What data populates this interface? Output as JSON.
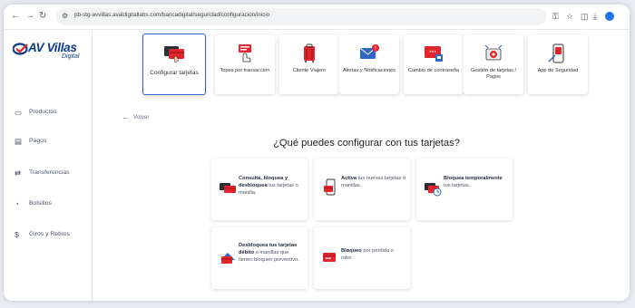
{
  "browser": {
    "url": "pb-stg-avvillas.avaldigitallabs.com/bancadigital/seguridad/configuracion/inicio",
    "back_icon": "arrow-left-icon",
    "forward_icon": "arrow-right-icon",
    "reload_icon": "reload-icon",
    "site_settings_icon": "tune-icon"
  },
  "logo": {
    "brand": "AV Villas",
    "sub": "Digital"
  },
  "sidebar": {
    "items": [
      {
        "label": "Productos",
        "icon": "product-icon"
      },
      {
        "label": "Pagos",
        "icon": "payments-icon"
      },
      {
        "label": "Transferencias",
        "icon": "transfer-icon"
      },
      {
        "label": "Bolsillos",
        "icon": "pocket-icon"
      },
      {
        "label": "Giros y Retiros",
        "icon": "withdraw-icon"
      }
    ]
  },
  "top_menu": [
    {
      "label": "Configurar tarjetas",
      "icon": "cards-hand-icon",
      "active": true
    },
    {
      "label": "Topes por transacción",
      "icon": "limits-icon"
    },
    {
      "label": "Cliente Viajero",
      "icon": "traveler-icon"
    },
    {
      "label": "Alertas y Notificaciones",
      "icon": "alert-mail-icon"
    },
    {
      "label": "Cambio de contraseña",
      "icon": "password-icon"
    },
    {
      "label": "Gestión de tarjetas / Pagos",
      "icon": "card-management-icon"
    },
    {
      "label": "App de Seguridad",
      "icon": "security-app-icon"
    }
  ],
  "content": {
    "back_label": "Volver",
    "heading": "¿Qué puedes configurar con tus tarjetas?"
  },
  "cards": [
    {
      "bold": "Consulta, bloquea y desbloquea",
      "rest": " tus tarjetas o manilla.",
      "icon": "cards-icon"
    },
    {
      "bold": "Activa",
      "rest": " tus nuevas tarjetas o manillas.",
      "icon": "activate-phone-icon"
    },
    {
      "bold_pre": "Bloquea ",
      "bold": "temporalmente",
      "rest": " tus tarjetas.",
      "icon": "temporary-lock-icon"
    },
    {
      "bold": "Desbloquea tus tarjetas débito",
      "rest": " o manillas que tienen bloqueo preventivo.",
      "icon": "unlock-debit-icon"
    },
    {
      "bold": "Bloqueo",
      "rest": " por pérdida o robo.",
      "icon": "lost-card-icon"
    }
  ],
  "colors": {
    "brand": "#0e3c8c",
    "accent_red": "#e0262c",
    "active_border": "#2f67c7"
  }
}
